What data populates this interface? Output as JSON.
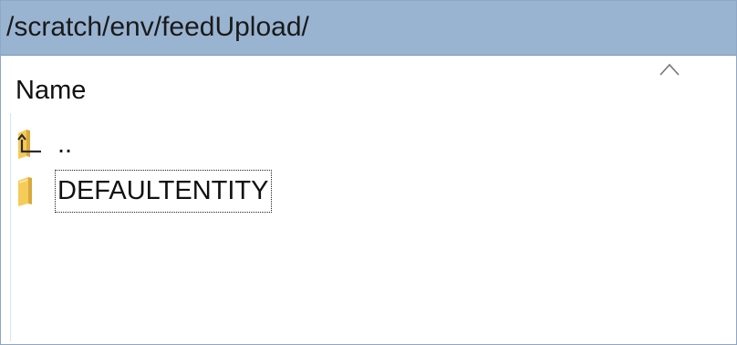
{
  "path_bar": {
    "path": "/scratch/env/feedUpload/"
  },
  "file_list": {
    "column_header": "Name",
    "sort_direction": "ascending",
    "rows": [
      {
        "label": "..",
        "icon": "folder-up-icon"
      },
      {
        "label": "DEFAULTENTITY",
        "icon": "folder-icon"
      }
    ]
  },
  "colors": {
    "path_bar_bg": "#99b4d1",
    "folder_yellow": "#f5cc5a"
  }
}
